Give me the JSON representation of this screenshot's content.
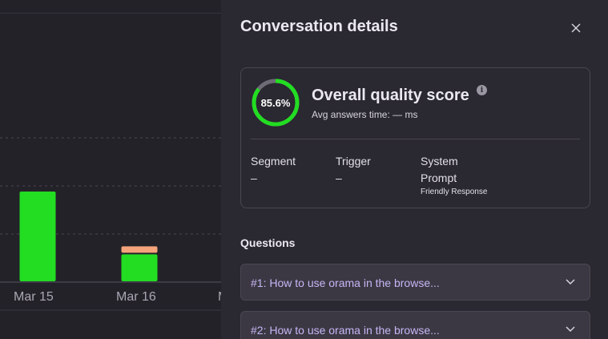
{
  "chart_data": {
    "type": "bar",
    "categories": [
      "Mar 15",
      "Mar 16"
    ],
    "series": [
      {
        "color": "#22dd22",
        "values": [
          3.5,
          1.05
        ]
      },
      {
        "color": "#f5a37a",
        "values": [
          0,
          0.25
        ]
      }
    ]
  },
  "panel": {
    "title": "Conversation details",
    "close_icon": "close-icon"
  },
  "score": {
    "value_text": "85.6%",
    "fraction": 0.856,
    "ring_color": "#22dd22",
    "track_color": "#6e6b76",
    "title": "Overall quality score",
    "info_icon": "info-icon",
    "info_glyph": "i",
    "avg_text": "Avg answers time: — ms"
  },
  "meta": {
    "segment_label": "Segment",
    "segment_value": "–",
    "trigger_label": "Trigger",
    "trigger_value": "–",
    "system_label_line1": "System",
    "system_label_line2": "Prompt",
    "system_value": "Friendly Response"
  },
  "questions": {
    "title": "Questions",
    "items": [
      {
        "label": "#1: How to use orama in the browse..."
      },
      {
        "label": "#2: How to use orama in the browse..."
      }
    ]
  }
}
